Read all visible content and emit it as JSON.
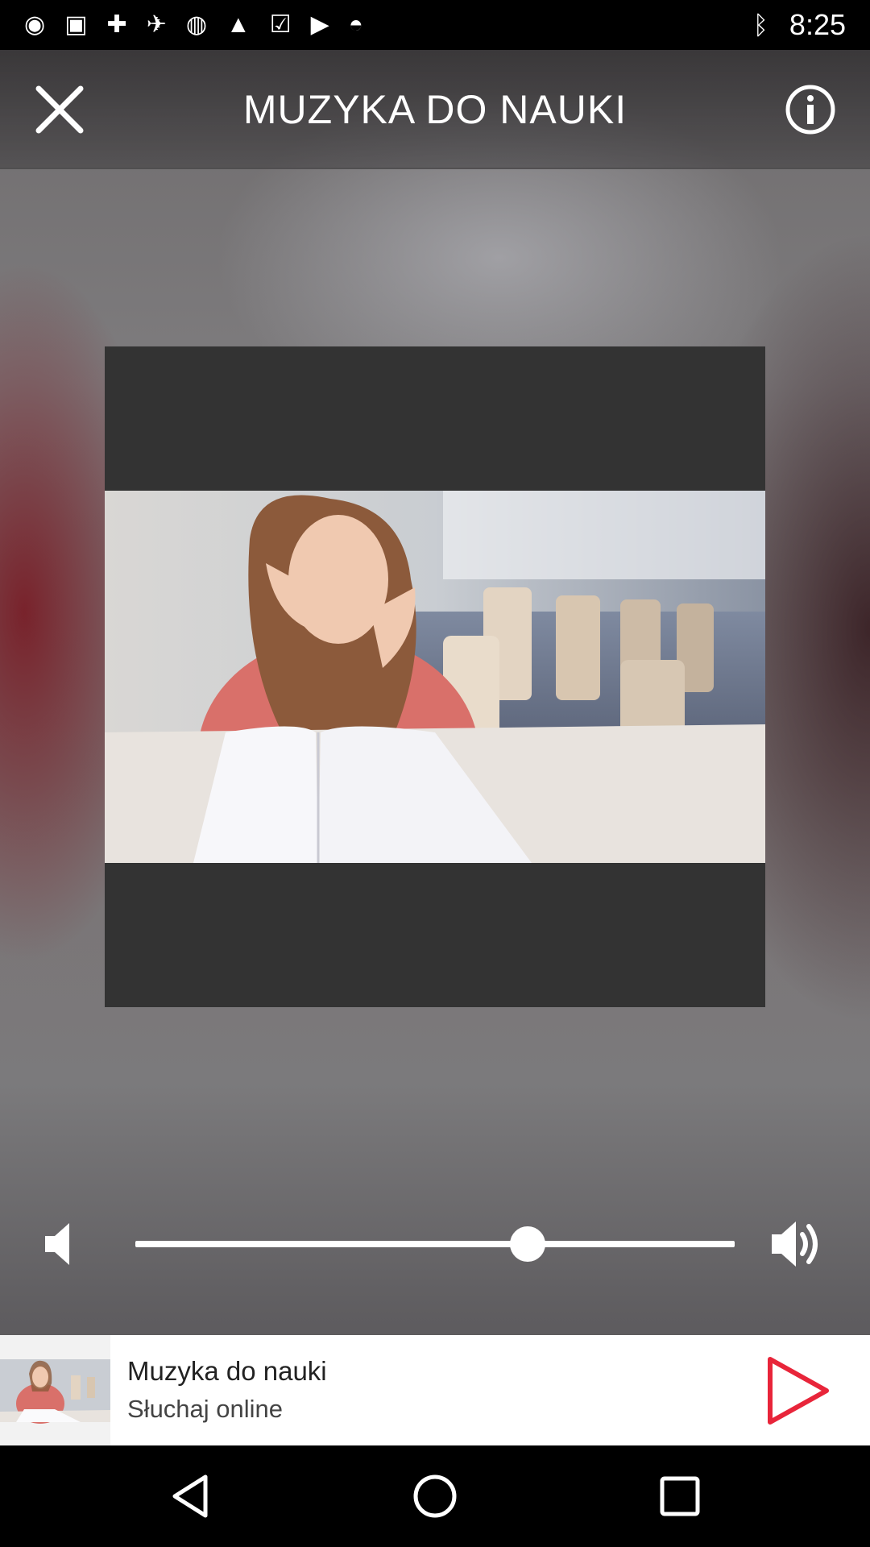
{
  "status_bar": {
    "time": "8:25",
    "left_icons": [
      "record-icon",
      "go-icon",
      "fake-gps-icon",
      "satellite-icon",
      "sync-icon",
      "lock-icon",
      "task-icon",
      "play-store-icon",
      "android-icon"
    ],
    "right_icons": [
      "bluetooth-icon",
      "vibrate-icon",
      "alarm-icon",
      "battery-icon",
      "signal-icon"
    ]
  },
  "header": {
    "title": "MUZYKA DO NAUKI",
    "close_icon": "close-icon",
    "info_icon": "info-icon"
  },
  "artwork": {
    "description_icon": "album-art"
  },
  "volume": {
    "level": 0.655,
    "low_icon": "volume-low-icon",
    "high_icon": "volume-high-icon"
  },
  "player": {
    "track_title": "Muzyka do nauki",
    "track_subtitle": "Słuchaj online",
    "play_icon": "play-icon",
    "accent_color": "#e8253a"
  },
  "nav": {
    "back_icon": "back-icon",
    "home_icon": "home-icon",
    "recents_icon": "recents-icon"
  }
}
